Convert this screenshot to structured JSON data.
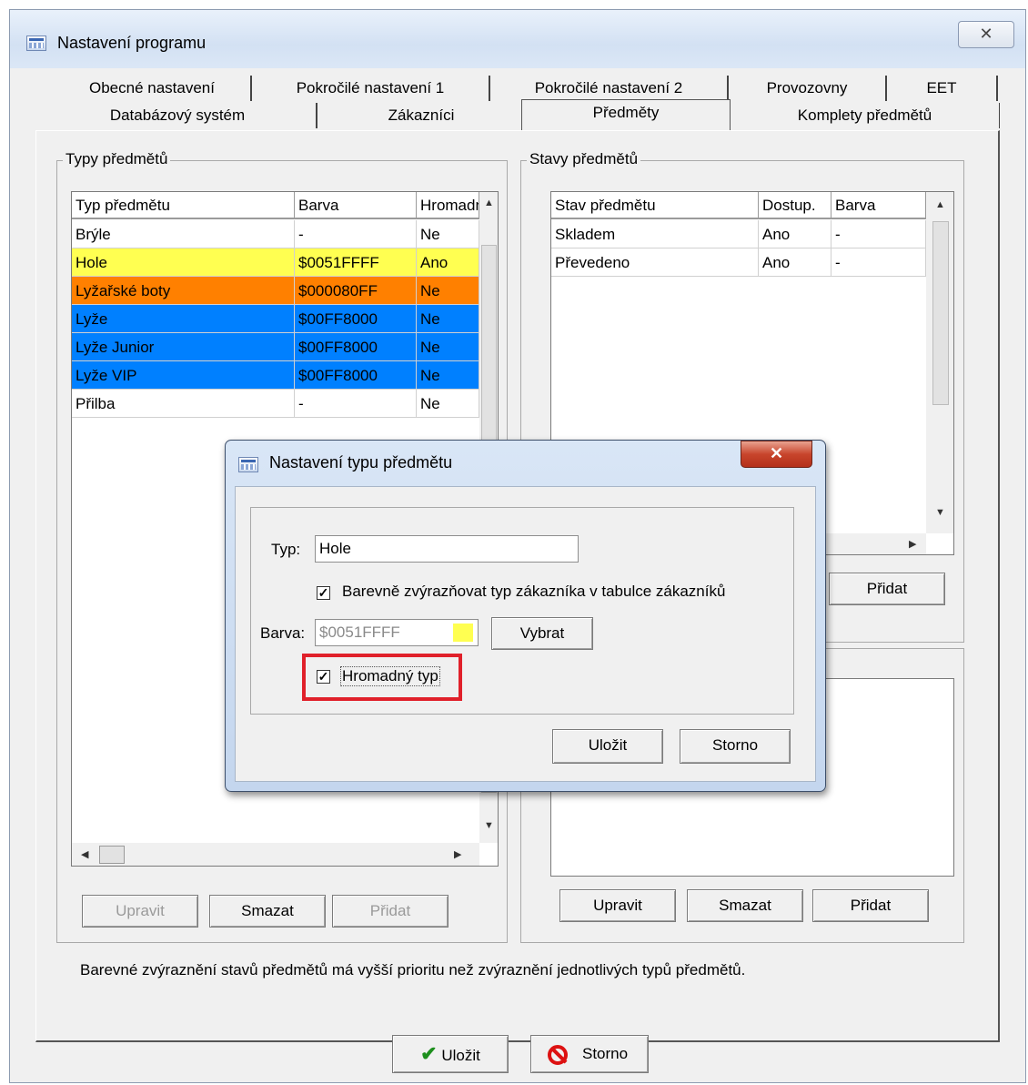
{
  "window": {
    "title": "Nastavení programu",
    "close_glyph": "✕"
  },
  "tabs": {
    "row1": [
      "Obecné nastavení",
      "Pokročilé nastavení 1",
      "Pokročilé nastavení 2",
      "Provozovny",
      "EET"
    ],
    "row2": [
      "Databázový systém",
      "Zákazníci",
      "Předměty",
      "Komplety předmětů"
    ],
    "active": "Předměty"
  },
  "types_group": {
    "title": "Typy předmětů",
    "columns": [
      "Typ předmětu",
      "Barva",
      "Hromadný"
    ],
    "rows": [
      {
        "name": "Brýle",
        "color": "-",
        "bulk": "Ne",
        "bg": "#ffffff"
      },
      {
        "name": "Hole",
        "color": "$0051FFFF",
        "bulk": "Ano",
        "bg": "#ffff51"
      },
      {
        "name": "Lyžařské boty",
        "color": "$000080FF",
        "bulk": "Ne",
        "bg": "#ff8000"
      },
      {
        "name": "Lyže",
        "color": "$00FF8000",
        "bulk": "Ne",
        "bg": "#0080ff"
      },
      {
        "name": "Lyže Junior",
        "color": "$00FF8000",
        "bulk": "Ne",
        "bg": "#0080ff"
      },
      {
        "name": "Lyže VIP",
        "color": "$00FF8000",
        "bulk": "Ne",
        "bg": "#0080ff"
      },
      {
        "name": "Přilba",
        "color": "-",
        "bulk": "Ne",
        "bg": "#ffffff"
      }
    ],
    "buttons": {
      "edit": "Upravit",
      "delete": "Smazat",
      "add": "Přidat"
    }
  },
  "states_group": {
    "title": "Stavy předmětů",
    "columns": [
      "Stav předmětu",
      "Dostup.",
      "Barva"
    ],
    "rows": [
      {
        "name": "Skladem",
        "available": "Ano",
        "color": "-"
      },
      {
        "name": "Převedeno",
        "available": "Ano",
        "color": "-"
      }
    ],
    "add_label": "Přidat"
  },
  "lower_group": {
    "buttons": {
      "edit": "Upravit",
      "delete": "Smazat",
      "add": "Přidat"
    }
  },
  "note": "Barevné zvýraznění stavů předmětů má vyšší prioritu než zvýraznění jednotlivých typů předmětů.",
  "footer": {
    "save": "Uložit",
    "cancel": "Storno"
  },
  "dialog": {
    "title": "Nastavení typu předmětu",
    "type_label": "Typ:",
    "type_value": "Hole",
    "highlight_label": "Barevně zvýrazňovat typ zákazníka v tabulce zákazníků",
    "highlight_checked": true,
    "color_label": "Barva:",
    "color_value": "$0051FFFF",
    "color_swatch": "#ffff51",
    "pick_label": "Vybrat",
    "bulk_label": "Hromadný typ",
    "bulk_checked": true,
    "save": "Uložit",
    "cancel": "Storno",
    "highlight_frame_color": "#e0202a"
  }
}
